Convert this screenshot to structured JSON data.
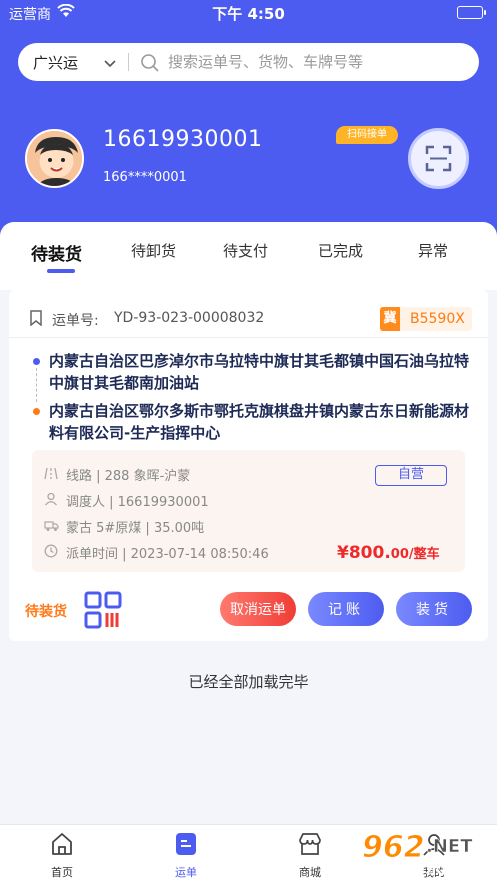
{
  "status_bar": {
    "carrier": "运营商",
    "time": "下午 4:50"
  },
  "search": {
    "city": "广兴运",
    "placeholder": "搜索运单号、货物、车牌号等"
  },
  "profile": {
    "phone": "16619930001",
    "masked_phone": "166****0001",
    "scan_tag": "扫码接单"
  },
  "tabs": [
    {
      "label": "待装货",
      "active": true
    },
    {
      "label": "待卸货",
      "active": false
    },
    {
      "label": "待支付",
      "active": false
    },
    {
      "label": "已完成",
      "active": false
    },
    {
      "label": "异常",
      "active": false
    }
  ],
  "order": {
    "waybill_label": "运单号:",
    "waybill_no": "YD-93-023-00008032",
    "plate_province": "冀",
    "plate_number": "B5590X",
    "from": "内蒙古自治区巴彦淖尔市乌拉特中旗甘其毛都镇中国石油乌拉特中旗甘其毛都南加油站",
    "to": "内蒙古自治区鄂尔多斯市鄂托克旗棋盘井镇内蒙古东日新能源材料有限公司-生产指挥中心",
    "route": "线路 | 288 象晖-沪蒙",
    "dispatcher": "调度人 | 16619930001",
    "cargo": "蒙古 5#原煤 | 35.00吨",
    "dispatch_time": "派单时间 | 2023-07-14 08:50:46",
    "badge": "自营",
    "price_main": "¥800.",
    "price_small": "00/整车",
    "status": "待装货",
    "buttons": {
      "cancel": "取消运单",
      "record": "记账",
      "load": "装货"
    }
  },
  "end_text": "已经全部加载完毕",
  "tabbar": [
    {
      "label": "首页",
      "icon": "home-icon"
    },
    {
      "label": "运单",
      "icon": "waybill-icon",
      "active": true
    },
    {
      "label": "商城",
      "icon": "shop-icon"
    },
    {
      "label": "我的",
      "icon": "user-icon"
    }
  ],
  "watermark": {
    "brand": "962",
    "suffix": ".NET",
    "sub": "乐游网"
  },
  "colors": {
    "primary": "#4d5cf0",
    "orange": "#ff7a1a",
    "red": "#ee2a2a"
  }
}
